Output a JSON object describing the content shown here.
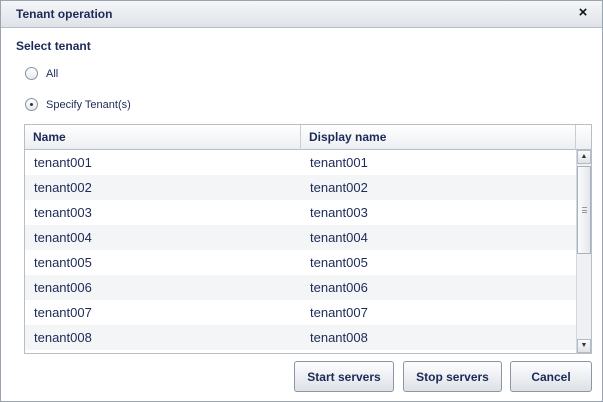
{
  "dialog": {
    "title": "Tenant operation",
    "close_icon": "×"
  },
  "select_tenant": {
    "label": "Select tenant",
    "options": [
      {
        "label": "All",
        "checked": false
      },
      {
        "label": "Specify Tenant(s)",
        "checked": true
      }
    ]
  },
  "grid": {
    "columns": [
      "Name",
      "Display name"
    ],
    "rows": [
      [
        "tenant001",
        "tenant001"
      ],
      [
        "tenant002",
        "tenant002"
      ],
      [
        "tenant003",
        "tenant003"
      ],
      [
        "tenant004",
        "tenant004"
      ],
      [
        "tenant005",
        "tenant005"
      ],
      [
        "tenant006",
        "tenant006"
      ],
      [
        "tenant007",
        "tenant007"
      ],
      [
        "tenant008",
        "tenant008"
      ]
    ],
    "scroll_up_icon": "▲",
    "scroll_down_icon": "▼"
  },
  "buttons": {
    "start": "Start servers",
    "stop": "Stop servers",
    "cancel": "Cancel"
  },
  "colors": {
    "text": "#1d2a57",
    "border": "#b7bec7",
    "stripe": "#f4f5f7"
  }
}
